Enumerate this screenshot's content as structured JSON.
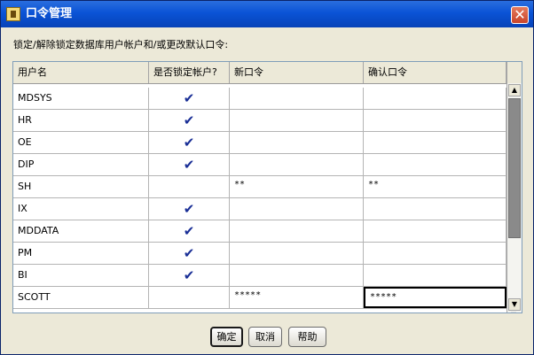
{
  "window": {
    "title": "口令管理",
    "close_symbol": "✕"
  },
  "instruction": "锁定/解除锁定数据库用户帐户和/或更改默认口令:",
  "table": {
    "columns": [
      "用户名",
      "是否锁定帐户?",
      "新口令",
      "确认口令"
    ],
    "rows": [
      {
        "user": "MDSYS",
        "locked": true,
        "new_password": "",
        "confirm_password": ""
      },
      {
        "user": "HR",
        "locked": true,
        "new_password": "",
        "confirm_password": ""
      },
      {
        "user": "OE",
        "locked": true,
        "new_password": "",
        "confirm_password": ""
      },
      {
        "user": "DIP",
        "locked": true,
        "new_password": "",
        "confirm_password": ""
      },
      {
        "user": "SH",
        "locked": false,
        "new_password": "**",
        "confirm_password": "**"
      },
      {
        "user": "IX",
        "locked": true,
        "new_password": "",
        "confirm_password": ""
      },
      {
        "user": "MDDATA",
        "locked": true,
        "new_password": "",
        "confirm_password": ""
      },
      {
        "user": "PM",
        "locked": true,
        "new_password": "",
        "confirm_password": ""
      },
      {
        "user": "BI",
        "locked": true,
        "new_password": "",
        "confirm_password": ""
      },
      {
        "user": "SCOTT",
        "locked": false,
        "new_password": "*****",
        "confirm_password": "*****"
      }
    ]
  },
  "buttons": {
    "ok": "确定",
    "cancel": "取消",
    "help": "帮助"
  },
  "scrollbar": {
    "up": "▲",
    "down": "▼"
  },
  "check_glyph": "✔"
}
